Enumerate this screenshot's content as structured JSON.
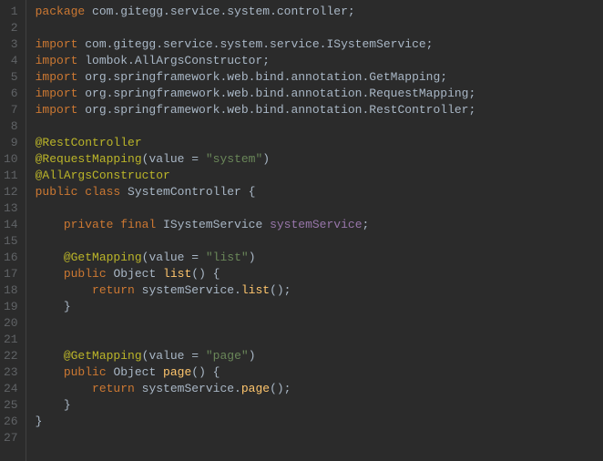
{
  "lines": [
    {
      "n": "1",
      "segs": [
        {
          "t": "package ",
          "c": "kw"
        },
        {
          "t": "com.gitegg.service.system.controller;",
          "c": "pkg"
        }
      ]
    },
    {
      "n": "2",
      "segs": []
    },
    {
      "n": "3",
      "segs": [
        {
          "t": "import ",
          "c": "kw"
        },
        {
          "t": "com.gitegg.service.system.service.ISystemService;",
          "c": "pkg"
        }
      ]
    },
    {
      "n": "4",
      "segs": [
        {
          "t": "import ",
          "c": "kw"
        },
        {
          "t": "lombok.AllArgsConstructor;",
          "c": "pkg"
        }
      ]
    },
    {
      "n": "5",
      "segs": [
        {
          "t": "import ",
          "c": "kw"
        },
        {
          "t": "org.springframework.web.bind.annotation.GetMapping;",
          "c": "pkg"
        }
      ]
    },
    {
      "n": "6",
      "segs": [
        {
          "t": "import ",
          "c": "kw"
        },
        {
          "t": "org.springframework.web.bind.annotation.RequestMapping;",
          "c": "pkg"
        }
      ]
    },
    {
      "n": "7",
      "segs": [
        {
          "t": "import ",
          "c": "kw"
        },
        {
          "t": "org.springframework.web.bind.annotation.RestController;",
          "c": "pkg"
        }
      ]
    },
    {
      "n": "8",
      "segs": []
    },
    {
      "n": "9",
      "segs": [
        {
          "t": "@RestController",
          "c": "ann"
        }
      ]
    },
    {
      "n": "10",
      "segs": [
        {
          "t": "@RequestMapping",
          "c": "ann"
        },
        {
          "t": "(value = ",
          "c": "paren"
        },
        {
          "t": "\"system\"",
          "c": "str"
        },
        {
          "t": ")",
          "c": "paren"
        }
      ]
    },
    {
      "n": "11",
      "segs": [
        {
          "t": "@AllArgsConstructor",
          "c": "ann"
        }
      ]
    },
    {
      "n": "12",
      "segs": [
        {
          "t": "public class ",
          "c": "kw"
        },
        {
          "t": "SystemController {",
          "c": "type"
        }
      ]
    },
    {
      "n": "13",
      "segs": []
    },
    {
      "n": "14",
      "segs": [
        {
          "t": "    ",
          "c": "pkg"
        },
        {
          "t": "private final ",
          "c": "kw"
        },
        {
          "t": "ISystemService ",
          "c": "type"
        },
        {
          "t": "systemService",
          "c": "field"
        },
        {
          "t": ";",
          "c": "pkg"
        }
      ]
    },
    {
      "n": "15",
      "segs": []
    },
    {
      "n": "16",
      "segs": [
        {
          "t": "    ",
          "c": "pkg"
        },
        {
          "t": "@GetMapping",
          "c": "ann"
        },
        {
          "t": "(value = ",
          "c": "paren"
        },
        {
          "t": "\"list\"",
          "c": "str"
        },
        {
          "t": ")",
          "c": "paren"
        }
      ]
    },
    {
      "n": "17",
      "segs": [
        {
          "t": "    ",
          "c": "pkg"
        },
        {
          "t": "public ",
          "c": "kw"
        },
        {
          "t": "Object ",
          "c": "type"
        },
        {
          "t": "list",
          "c": "method"
        },
        {
          "t": "() {",
          "c": "paren"
        }
      ]
    },
    {
      "n": "18",
      "segs": [
        {
          "t": "        ",
          "c": "pkg"
        },
        {
          "t": "return ",
          "c": "kw"
        },
        {
          "t": "systemService.",
          "c": "pkg"
        },
        {
          "t": "list",
          "c": "method"
        },
        {
          "t": "();",
          "c": "paren"
        }
      ]
    },
    {
      "n": "19",
      "segs": [
        {
          "t": "    }",
          "c": "pkg"
        }
      ]
    },
    {
      "n": "20",
      "segs": []
    },
    {
      "n": "21",
      "segs": []
    },
    {
      "n": "22",
      "segs": [
        {
          "t": "    ",
          "c": "pkg"
        },
        {
          "t": "@GetMapping",
          "c": "ann"
        },
        {
          "t": "(value = ",
          "c": "paren"
        },
        {
          "t": "\"page\"",
          "c": "str"
        },
        {
          "t": ")",
          "c": "paren"
        }
      ]
    },
    {
      "n": "23",
      "segs": [
        {
          "t": "    ",
          "c": "pkg"
        },
        {
          "t": "public ",
          "c": "kw"
        },
        {
          "t": "Object ",
          "c": "type"
        },
        {
          "t": "page",
          "c": "method"
        },
        {
          "t": "() {",
          "c": "paren"
        }
      ]
    },
    {
      "n": "24",
      "segs": [
        {
          "t": "        ",
          "c": "pkg"
        },
        {
          "t": "return ",
          "c": "kw"
        },
        {
          "t": "systemService.",
          "c": "pkg"
        },
        {
          "t": "page",
          "c": "method"
        },
        {
          "t": "();",
          "c": "paren"
        }
      ]
    },
    {
      "n": "25",
      "segs": [
        {
          "t": "    }",
          "c": "pkg"
        }
      ]
    },
    {
      "n": "26",
      "segs": [
        {
          "t": "}",
          "c": "pkg"
        }
      ]
    },
    {
      "n": "27",
      "segs": []
    }
  ]
}
